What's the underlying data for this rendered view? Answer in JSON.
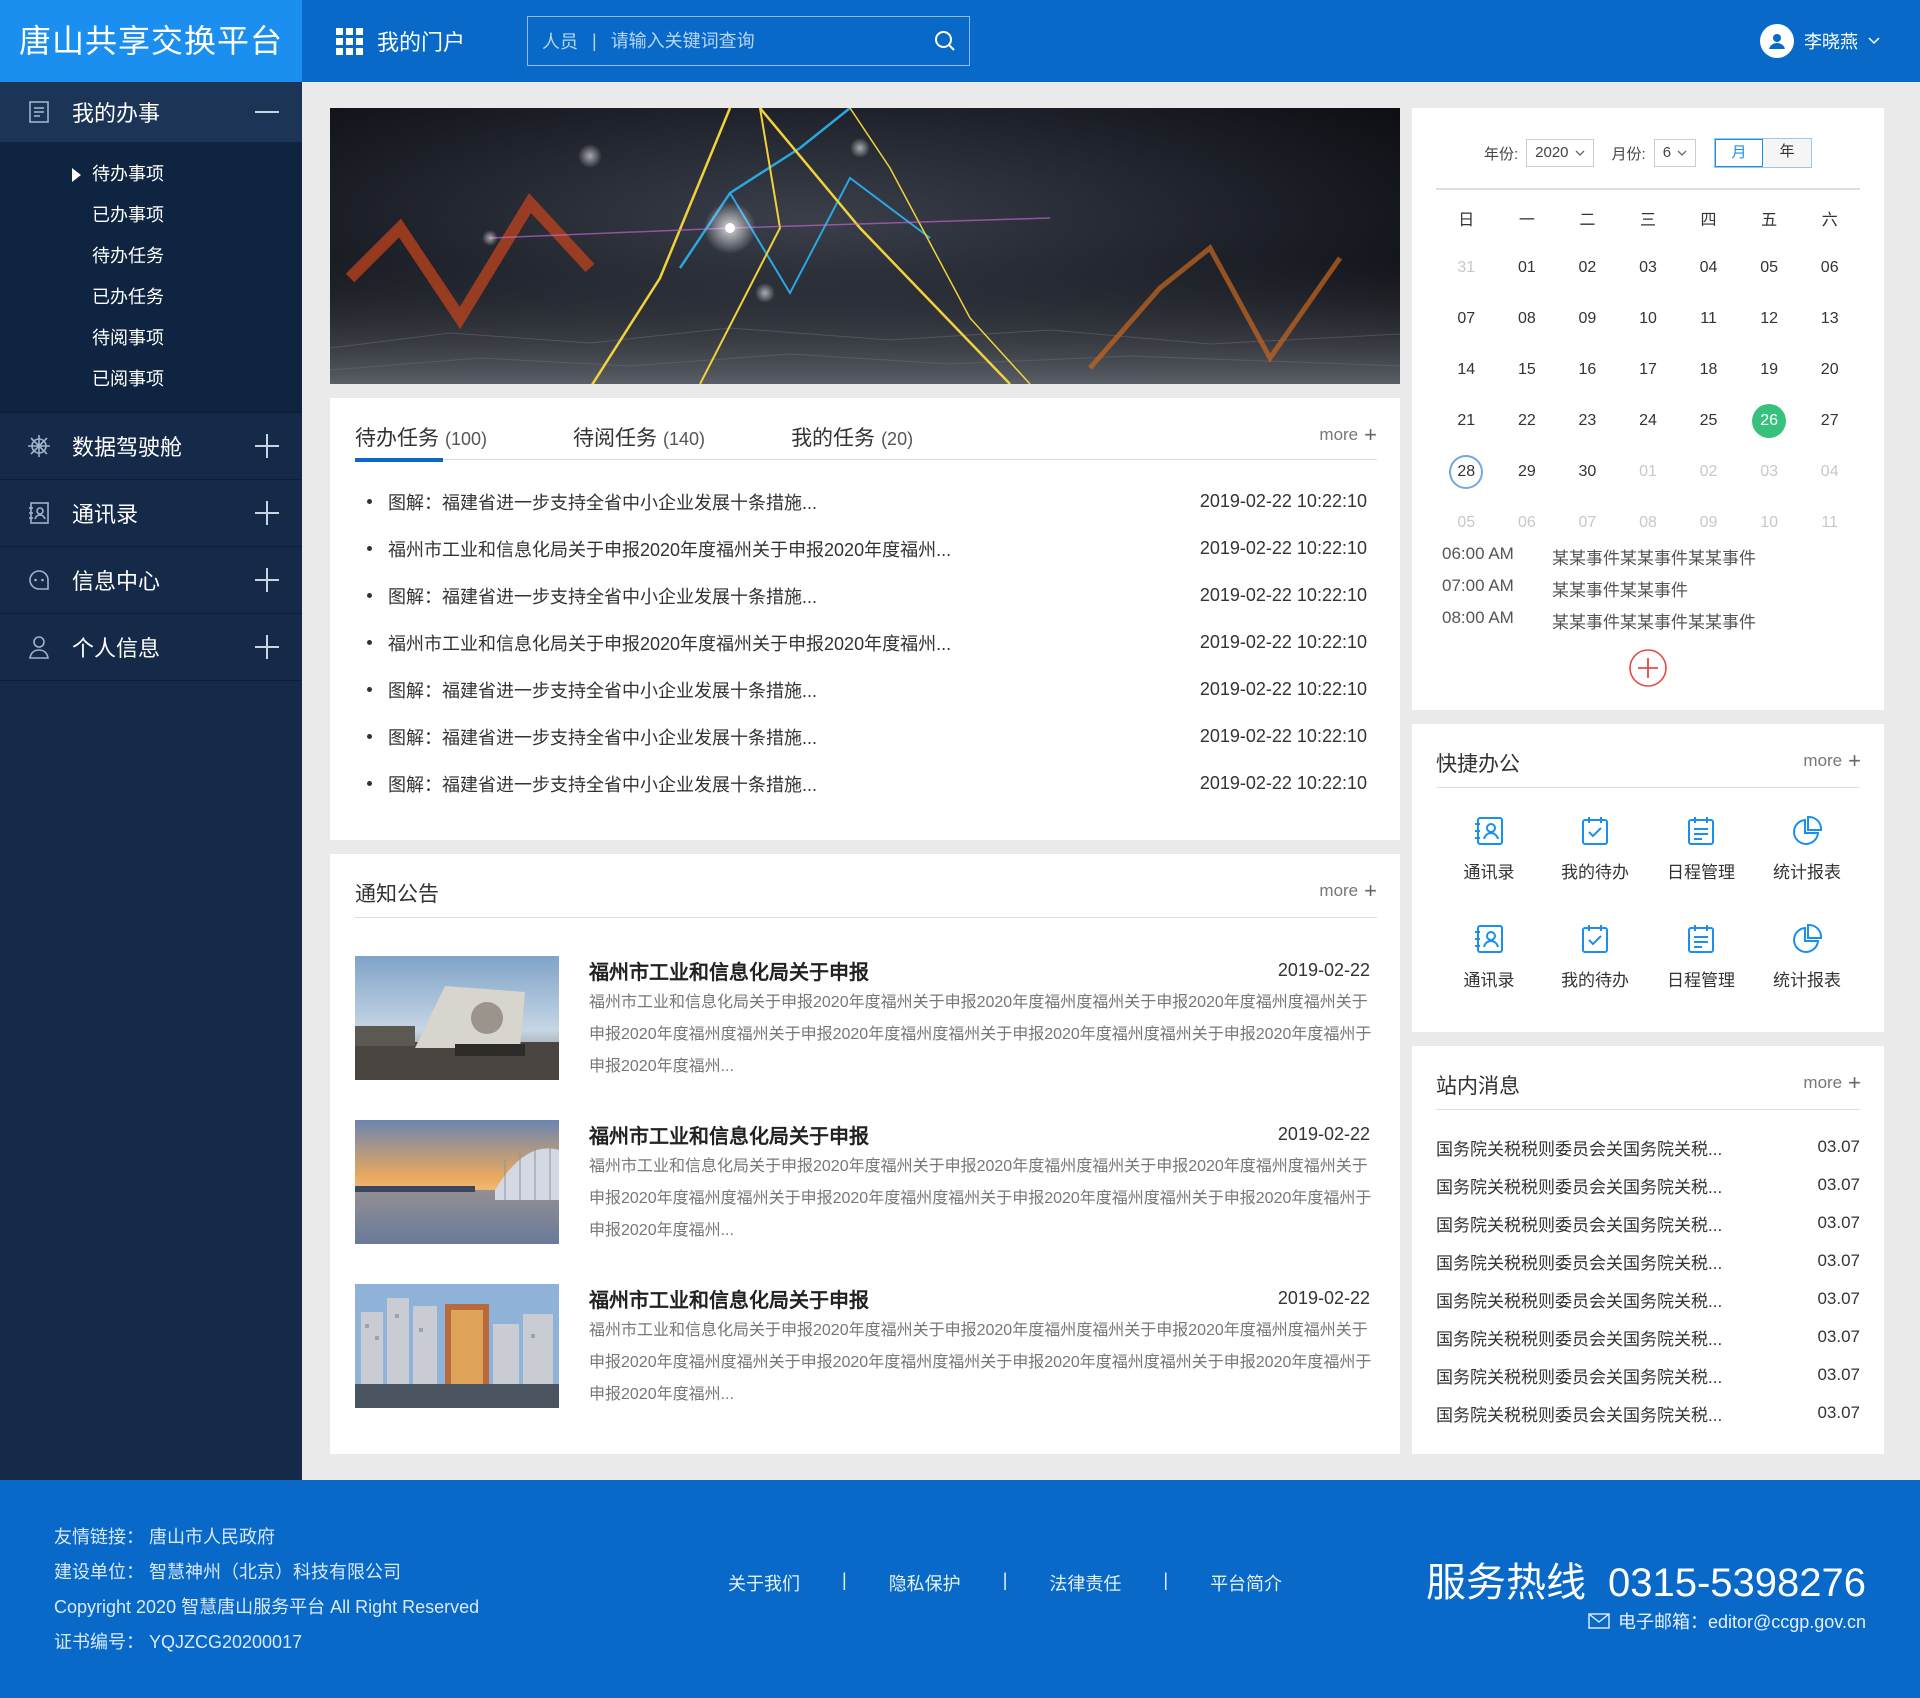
{
  "header": {
    "brand": "唐山共享交换平台",
    "portal": "我的门户",
    "search": {
      "scope": "人员",
      "placeholder": "请输入关键词查询"
    },
    "user": "李晓燕"
  },
  "sidebar": {
    "sections": [
      {
        "label": "我的办事",
        "expanded": true,
        "items": [
          "待办事项",
          "已办事项",
          "待办任务",
          "已办任务",
          "待阅事项",
          "已阅事项"
        ]
      },
      {
        "label": "数据驾驶舱"
      },
      {
        "label": "通讯录"
      },
      {
        "label": "信息中心"
      },
      {
        "label": "个人信息"
      }
    ]
  },
  "tasks": {
    "tabs": [
      {
        "label": "待办任务",
        "count": "(100)"
      },
      {
        "label": "待阅任务",
        "count": "(140)"
      },
      {
        "label": "我的任务",
        "count": "(20)"
      }
    ],
    "more": "more",
    "rows": [
      {
        "title": "图解：福建省进一步支持全省中小企业发展十条措施...",
        "date": "2019-02-22  10:22:10"
      },
      {
        "title": "福州市工业和信息化局关于申报2020年度福州关于申报2020年度福州...",
        "date": "2019-02-22  10:22:10"
      },
      {
        "title": "图解：福建省进一步支持全省中小企业发展十条措施...",
        "date": "2019-02-22  10:22:10"
      },
      {
        "title": "福州市工业和信息化局关于申报2020年度福州关于申报2020年度福州...",
        "date": "2019-02-22  10:22:10"
      },
      {
        "title": "图解：福建省进一步支持全省中小企业发展十条措施...",
        "date": "2019-02-22  10:22:10"
      },
      {
        "title": "图解：福建省进一步支持全省中小企业发展十条措施...",
        "date": "2019-02-22  10:22:10"
      },
      {
        "title": "图解：福建省进一步支持全省中小企业发展十条措施...",
        "date": "2019-02-22  10:22:10"
      }
    ]
  },
  "notice": {
    "title": "通知公告",
    "more": "more",
    "items": [
      {
        "title": "福州市工业和信息化局关于申报",
        "date": "2019-02-22",
        "body": "福州市工业和信息化局关于申报2020年度福州关于申报2020年度福州度福州关于申报2020年度福州度福州关于申报2020年度福州度福州关于申报2020年度福州度福州关于申报2020年度福州度福州关于申报2020年度福州于申报2020年度福州..."
      },
      {
        "title": "福州市工业和信息化局关于申报",
        "date": "2019-02-22",
        "body": "福州市工业和信息化局关于申报2020年度福州关于申报2020年度福州度福州关于申报2020年度福州度福州关于申报2020年度福州度福州关于申报2020年度福州度福州关于申报2020年度福州度福州关于申报2020年度福州于申报2020年度福州..."
      },
      {
        "title": "福州市工业和信息化局关于申报",
        "date": "2019-02-22",
        "body": "福州市工业和信息化局关于申报2020年度福州关于申报2020年度福州度福州关于申报2020年度福州度福州关于申报2020年度福州度福州关于申报2020年度福州度福州关于申报2020年度福州度福州关于申报2020年度福州于申报2020年度福州..."
      }
    ]
  },
  "calendar": {
    "year_label": "年份:",
    "year": "2020",
    "month_label": "月份:",
    "month": "6",
    "view_month": "月",
    "view_year": "年",
    "weekdays": [
      "日",
      "一",
      "二",
      "三",
      "四",
      "五",
      "六"
    ],
    "days": [
      {
        "d": "31",
        "o": true
      },
      {
        "d": "01"
      },
      {
        "d": "02"
      },
      {
        "d": "03"
      },
      {
        "d": "04"
      },
      {
        "d": "05"
      },
      {
        "d": "06"
      },
      {
        "d": "07"
      },
      {
        "d": "08"
      },
      {
        "d": "09"
      },
      {
        "d": "10"
      },
      {
        "d": "11"
      },
      {
        "d": "12"
      },
      {
        "d": "13"
      },
      {
        "d": "14"
      },
      {
        "d": "15"
      },
      {
        "d": "16"
      },
      {
        "d": "17"
      },
      {
        "d": "18"
      },
      {
        "d": "19"
      },
      {
        "d": "20"
      },
      {
        "d": "21"
      },
      {
        "d": "22"
      },
      {
        "d": "23"
      },
      {
        "d": "24"
      },
      {
        "d": "25"
      },
      {
        "d": "26",
        "today": true
      },
      {
        "d": "27"
      },
      {
        "d": "28",
        "selected": true
      },
      {
        "d": "29"
      },
      {
        "d": "30"
      },
      {
        "d": "01",
        "o": true
      },
      {
        "d": "02",
        "o": true
      },
      {
        "d": "03",
        "o": true
      },
      {
        "d": "04",
        "o": true
      },
      {
        "d": "05",
        "o": true
      },
      {
        "d": "06",
        "o": true
      },
      {
        "d": "07",
        "o": true
      },
      {
        "d": "08",
        "o": true
      },
      {
        "d": "09",
        "o": true
      },
      {
        "d": "10",
        "o": true
      },
      {
        "d": "11",
        "o": true
      }
    ],
    "events": [
      {
        "time": "06:00  AM",
        "text": "某某事件某某事件某某事件"
      },
      {
        "time": "07:00  AM",
        "text": "某某事件某某事件"
      },
      {
        "time": "08:00  AM",
        "text": "某某事件某某事件某某事件"
      }
    ],
    "today_color": "#36c27d"
  },
  "quick": {
    "title": "快捷办公",
    "more": "more",
    "items": [
      {
        "label": "通讯录",
        "icon": "contacts-icon"
      },
      {
        "label": "我的待办",
        "icon": "todo-check-icon"
      },
      {
        "label": "日程管理",
        "icon": "schedule-icon"
      },
      {
        "label": "统计报表",
        "icon": "pie-chart-icon"
      },
      {
        "label": "通讯录",
        "icon": "contacts-icon"
      },
      {
        "label": "我的待办",
        "icon": "todo-check-icon"
      },
      {
        "label": "日程管理",
        "icon": "schedule-icon"
      },
      {
        "label": "统计报表",
        "icon": "pie-chart-icon"
      }
    ]
  },
  "messages": {
    "title": "站内消息",
    "more": "more",
    "items": [
      {
        "title": "国务院关税税则委员会关国务院关税...",
        "date": "03.07"
      },
      {
        "title": "国务院关税税则委员会关国务院关税...",
        "date": "03.07"
      },
      {
        "title": "国务院关税税则委员会关国务院关税...",
        "date": "03.07"
      },
      {
        "title": "国务院关税税则委员会关国务院关税...",
        "date": "03.07"
      },
      {
        "title": "国务院关税税则委员会关国务院关税...",
        "date": "03.07"
      },
      {
        "title": "国务院关税税则委员会关国务院关税...",
        "date": "03.07"
      },
      {
        "title": "国务院关税税则委员会关国务院关税...",
        "date": "03.07"
      },
      {
        "title": "国务院关税税则委员会关国务院关税...",
        "date": "03.07"
      }
    ]
  },
  "footer": {
    "links_label": "友情链接：  唐山市人民政府",
    "builder": "建设单位：  智慧神州（北京）科技有限公司",
    "copyright": "Copyright 2020 智慧唐山服务平台 All Right Reserved",
    "cert": "证书编号：  YQJZCG20200017",
    "nav": [
      "关于我们",
      "隐私保护",
      "法律责任",
      "平台简介"
    ],
    "hotline_label": "服务热线",
    "hotline": "0315-5398276",
    "email": "电子邮箱：editor@ccgp.gov.cn"
  },
  "colors": {
    "primary": "#0869c8",
    "brand_bg": "#1b8ff0",
    "sidebar": "#142a48"
  }
}
